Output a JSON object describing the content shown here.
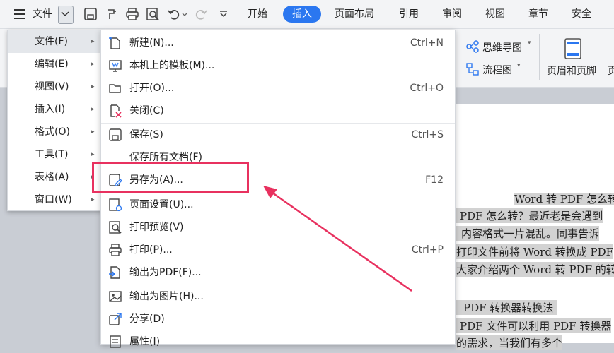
{
  "menubar": {
    "file_label": "文件",
    "tabs": [
      "开始",
      "插入",
      "页面布局",
      "引用",
      "审阅",
      "视图",
      "章节",
      "安全"
    ]
  },
  "ribbon": {
    "mindmap": "思维导图",
    "flowchart": "流程图",
    "header_footer": "页眉和页脚",
    "partial_right": "页"
  },
  "left_menu": {
    "items": [
      {
        "label": "文件(F)"
      },
      {
        "label": "编辑(E)"
      },
      {
        "label": "视图(V)"
      },
      {
        "label": "插入(I)"
      },
      {
        "label": "格式(O)"
      },
      {
        "label": "工具(T)"
      },
      {
        "label": "表格(A)"
      },
      {
        "label": "窗口(W)"
      }
    ],
    "arrow": "▸"
  },
  "submenu": {
    "items": [
      {
        "label": "新建(N)...",
        "shortcut": "Ctrl+N",
        "icon": "new-doc-icon"
      },
      {
        "label": "本机上的模板(M)...",
        "shortcut": "",
        "icon": "template-icon"
      },
      {
        "label": "打开(O)...",
        "shortcut": "Ctrl+O",
        "icon": "folder-open-icon"
      },
      {
        "label": "关闭(C)",
        "shortcut": "",
        "icon": "close-doc-icon"
      },
      {
        "label": "保存(S)",
        "shortcut": "Ctrl+S",
        "icon": "save-icon"
      },
      {
        "label": "保存所有文档(F)",
        "shortcut": "",
        "icon": ""
      },
      {
        "label": "另存为(A)...",
        "shortcut": "F12",
        "icon": "save-as-icon"
      },
      {
        "label": "页面设置(U)...",
        "shortcut": "",
        "icon": "page-setup-icon"
      },
      {
        "label": "打印预览(V)",
        "shortcut": "",
        "icon": "print-preview-icon"
      },
      {
        "label": "打印(P)...",
        "shortcut": "Ctrl+P",
        "icon": "printer-icon"
      },
      {
        "label": "输出为PDF(F)...",
        "shortcut": "",
        "icon": "export-pdf-icon"
      },
      {
        "label": "输出为图片(H)...",
        "shortcut": "",
        "icon": "export-image-icon"
      },
      {
        "label": "分享(D)",
        "shortcut": "",
        "icon": "share-icon"
      },
      {
        "label": "属性(I)",
        "shortcut": "",
        "icon": "properties-icon"
      }
    ]
  },
  "document": {
    "lines": [
      "Word 转 PDF 怎么转",
      "PDF 怎么转？最近老是会遇到",
      "内容格式一片混乱。同事告诉",
      "打印文件前将 Word 转换成 PDF",
      "大家介绍两个 Word 转 PDF 的转",
      "PDF 转换器转换法",
      "PDF 文件可以利用 PDF 转换器",
      "的需求，当我们有多个"
    ]
  },
  "colors": {
    "accent": "#2b77f0",
    "highlight_box": "#e8315f"
  }
}
